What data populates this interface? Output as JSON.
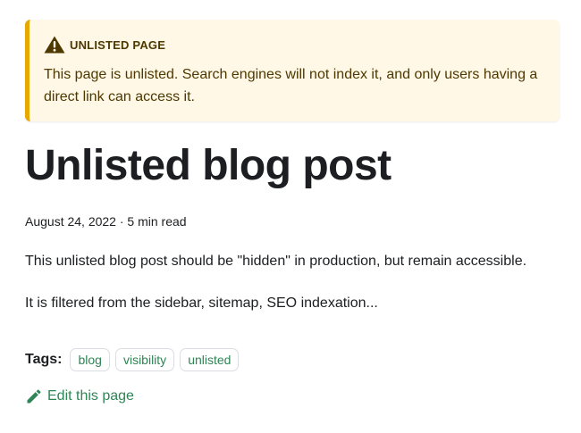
{
  "admonition": {
    "icon": "warning-triangle-icon",
    "heading": "UNLISTED PAGE",
    "text": "This page is unlisted. Search engines will not index it, and only users having a direct link can access it.",
    "accent_color": "#e6a700",
    "background_color": "#fff8e6"
  },
  "post": {
    "title": "Unlisted blog post",
    "meta": "August 24, 2022 · 5 min read",
    "paragraphs": [
      "This unlisted blog post should be \"hidden\" in production, but remain accessible.",
      "It is filtered from the sidebar, sitemap, SEO indexation..."
    ]
  },
  "tags": {
    "label": "Tags:",
    "items": [
      "blog",
      "visibility",
      "unlisted"
    ]
  },
  "edit": {
    "icon": "pencil-icon",
    "label": "Edit this page"
  },
  "colors": {
    "link": "#2e8555",
    "text": "#1c1e21"
  }
}
